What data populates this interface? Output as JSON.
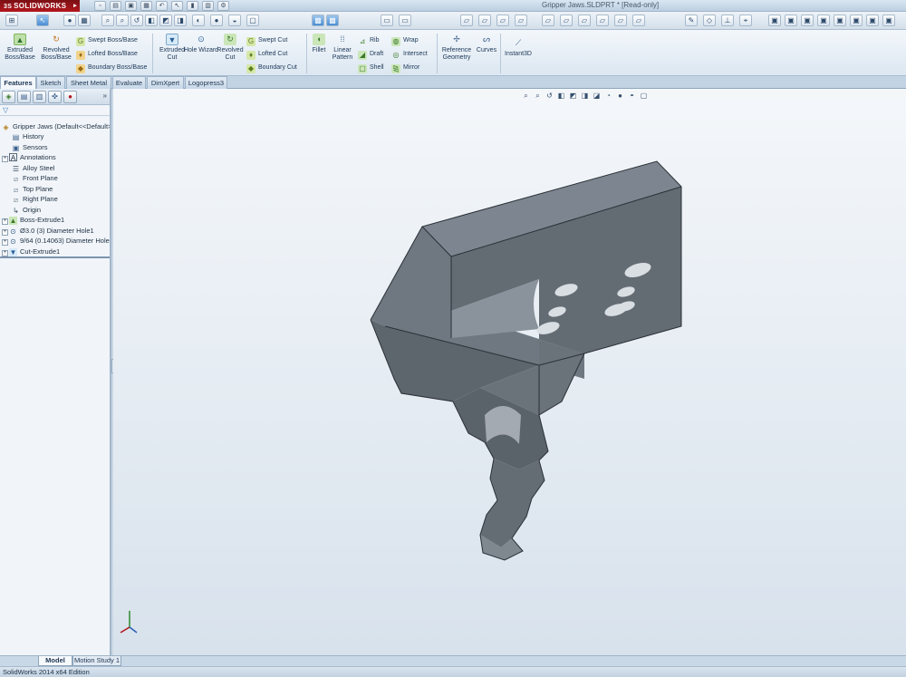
{
  "app": {
    "brand": "SOLIDWORKS",
    "document_title": "Gripper Jaws.SLDPRT * [Read-only]"
  },
  "command_manager": {
    "extruded_boss": "Extruded Boss/Base",
    "revolved_boss": "Revolved Boss/Base",
    "swept_boss": "Swept Boss/Base",
    "lofted_boss": "Lofted Boss/Base",
    "boundary_boss": "Boundary Boss/Base",
    "extruded_cut": "Extruded Cut",
    "hole_wizard": "Hole Wizard",
    "revolved_cut": "Revolved Cut",
    "swept_cut": "Swept Cut",
    "lofted_cut": "Lofted Cut",
    "boundary_cut": "Boundary Cut",
    "fillet": "Fillet",
    "linear_pattern": "Linear Pattern",
    "rib": "Rib",
    "draft": "Draft",
    "shell": "Shell",
    "wrap": "Wrap",
    "intersect": "Intersect",
    "mirror": "Mirror",
    "reference_geometry": "Reference Geometry",
    "curves": "Curves",
    "instant3d": "Instant3D"
  },
  "tabs": [
    "Features",
    "Sketch",
    "Sheet Metal",
    "Evaluate",
    "DimXpert",
    "Logopress3"
  ],
  "feature_tree": {
    "root": "Gripper Jaws  (Default<<Default>",
    "items": [
      {
        "label": "History",
        "icon": "history-icon",
        "expandable": false
      },
      {
        "label": "Sensors",
        "icon": "sensor-icon",
        "expandable": false
      },
      {
        "label": "Annotations",
        "icon": "annotation-icon",
        "expandable": true
      },
      {
        "label": "Alloy Steel",
        "icon": "material-icon",
        "expandable": false
      },
      {
        "label": "Front Plane",
        "icon": "plane-icon",
        "expandable": false
      },
      {
        "label": "Top Plane",
        "icon": "plane-icon",
        "expandable": false
      },
      {
        "label": "Right Plane",
        "icon": "plane-icon",
        "expandable": false
      },
      {
        "label": "Origin",
        "icon": "origin-icon",
        "expandable": false
      },
      {
        "label": "Boss-Extrude1",
        "icon": "extrude-icon",
        "expandable": true
      },
      {
        "label": "Ø3.0 (3) Diameter Hole1",
        "icon": "hole-icon",
        "expandable": true
      },
      {
        "label": "9/64 (0.14063) Diameter Hole1",
        "icon": "hole-icon",
        "expandable": true
      },
      {
        "label": "Cut-Extrude1",
        "icon": "cut-icon",
        "expandable": true
      }
    ]
  },
  "bottom_tabs": [
    "Model",
    "Motion Study 1"
  ],
  "status": "SolidWorks 2014 x64 Edition",
  "colors": {
    "brand_red": "#b3161c",
    "part_top": "#7d8690",
    "part_front": "#6b737c",
    "part_side": "#5b636b",
    "hole_fill": "#d9dee3"
  }
}
